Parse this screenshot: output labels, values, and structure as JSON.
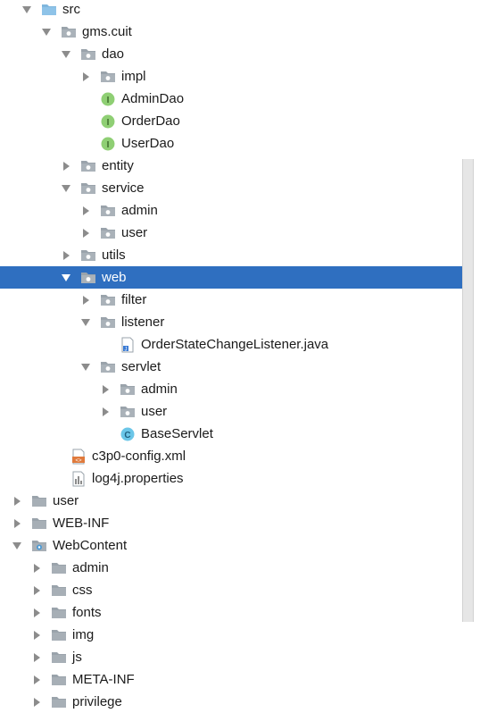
{
  "colors": {
    "selection": "#2f6fc0",
    "folder": "#9aa3ab",
    "interface_badge": "#8fcf74",
    "class_badge": "#6bc6e8"
  },
  "tree": [
    {
      "label": "src",
      "icon": "folder-src-icon",
      "arrow": "expanded",
      "depth": 0
    },
    {
      "label": "gms.cuit",
      "icon": "package-icon",
      "arrow": "expanded",
      "depth": 1
    },
    {
      "label": "dao",
      "icon": "package-icon",
      "arrow": "expanded",
      "depth": 2
    },
    {
      "label": "impl",
      "icon": "package-icon",
      "arrow": "collapsed",
      "depth": 3
    },
    {
      "label": "AdminDao",
      "icon": "interface-icon",
      "arrow": "none",
      "depth": 3
    },
    {
      "label": "OrderDao",
      "icon": "interface-icon",
      "arrow": "none",
      "depth": 3
    },
    {
      "label": "UserDao",
      "icon": "interface-icon",
      "arrow": "none",
      "depth": 3
    },
    {
      "label": "entity",
      "icon": "package-icon",
      "arrow": "collapsed",
      "depth": 2
    },
    {
      "label": "service",
      "icon": "package-icon",
      "arrow": "expanded",
      "depth": 2
    },
    {
      "label": "admin",
      "icon": "package-icon",
      "arrow": "collapsed",
      "depth": 3
    },
    {
      "label": "user",
      "icon": "package-icon",
      "arrow": "collapsed",
      "depth": 3
    },
    {
      "label": "utils",
      "icon": "package-icon",
      "arrow": "collapsed",
      "depth": 2
    },
    {
      "label": "web",
      "icon": "package-icon",
      "arrow": "expanded",
      "depth": 2,
      "selected": true
    },
    {
      "label": "filter",
      "icon": "package-icon",
      "arrow": "collapsed",
      "depth": 3
    },
    {
      "label": "listener",
      "icon": "package-icon",
      "arrow": "expanded",
      "depth": 3
    },
    {
      "label": "OrderStateChangeListener.java",
      "icon": "java-file-icon",
      "arrow": "none",
      "depth": 4
    },
    {
      "label": "servlet",
      "icon": "package-icon",
      "arrow": "expanded",
      "depth": 3
    },
    {
      "label": "admin",
      "icon": "package-icon",
      "arrow": "collapsed",
      "depth": 4
    },
    {
      "label": "user",
      "icon": "package-icon",
      "arrow": "collapsed",
      "depth": 4
    },
    {
      "label": "BaseServlet",
      "icon": "class-icon",
      "arrow": "none",
      "depth": 4
    },
    {
      "label": "c3p0-config.xml",
      "icon": "xml-file-icon",
      "arrow": "none",
      "depth": 1.5
    },
    {
      "label": "log4j.properties",
      "icon": "properties-file-icon",
      "arrow": "none",
      "depth": 1.5
    },
    {
      "label": "user",
      "icon": "folder-icon",
      "arrow": "collapsed",
      "depth": -0.5
    },
    {
      "label": "WEB-INF",
      "icon": "folder-icon",
      "arrow": "collapsed",
      "depth": -0.5
    },
    {
      "label": "WebContent",
      "icon": "web-folder-icon",
      "arrow": "expanded",
      "depth": -0.5
    },
    {
      "label": "admin",
      "icon": "folder-icon",
      "arrow": "collapsed",
      "depth": 0.5
    },
    {
      "label": "css",
      "icon": "folder-icon",
      "arrow": "collapsed",
      "depth": 0.5
    },
    {
      "label": "fonts",
      "icon": "folder-icon",
      "arrow": "collapsed",
      "depth": 0.5
    },
    {
      "label": "img",
      "icon": "folder-icon",
      "arrow": "collapsed",
      "depth": 0.5
    },
    {
      "label": "js",
      "icon": "folder-icon",
      "arrow": "collapsed",
      "depth": 0.5
    },
    {
      "label": "META-INF",
      "icon": "folder-icon",
      "arrow": "collapsed",
      "depth": 0.5
    },
    {
      "label": "privilege",
      "icon": "folder-icon",
      "arrow": "collapsed",
      "depth": 0.5
    }
  ]
}
